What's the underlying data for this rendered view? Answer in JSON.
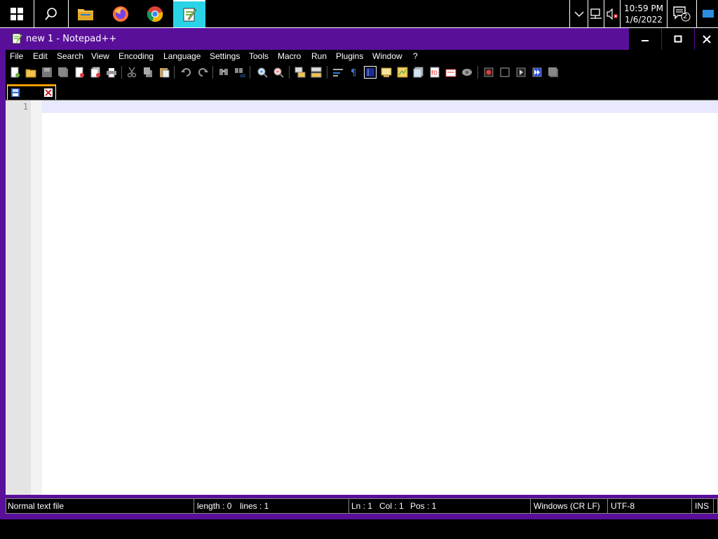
{
  "taskbar": {
    "apps": [
      {
        "name": "start",
        "icon": "windows-icon"
      },
      {
        "name": "search",
        "icon": "search-icon"
      },
      {
        "name": "file-explorer",
        "icon": "folder-icon"
      },
      {
        "name": "firefox",
        "icon": "firefox-icon"
      },
      {
        "name": "chrome",
        "icon": "chrome-icon"
      },
      {
        "name": "notepad-plus-plus",
        "icon": "notepad-icon",
        "active": true
      }
    ],
    "clock_time": "10:59 PM",
    "clock_date": "1/6/2022",
    "notification_count": "2"
  },
  "window": {
    "title": "new 1 - Notepad++",
    "minimize": "—",
    "maximize": "□",
    "close": "✕"
  },
  "menu": {
    "items": [
      "File",
      "Edit",
      "Search",
      "View",
      "Encoding",
      "Language",
      "Settings",
      "Tools",
      "Macro",
      "Run",
      "Plugins",
      "Window",
      "?"
    ]
  },
  "editor": {
    "line_number": "1"
  },
  "status": {
    "file_type": "Normal text file",
    "length": "length : 0",
    "lines": "lines : 1",
    "ln": "Ln : 1",
    "col": "Col : 1",
    "pos": "Pos : 1",
    "eol": "Windows (CR LF)",
    "encoding": "UTF-8",
    "mode": "INS"
  },
  "colors": {
    "window_frame": "#5a0f9a",
    "taskbar_active": "#2ad4e6",
    "tab_accent": "#f39c00"
  }
}
